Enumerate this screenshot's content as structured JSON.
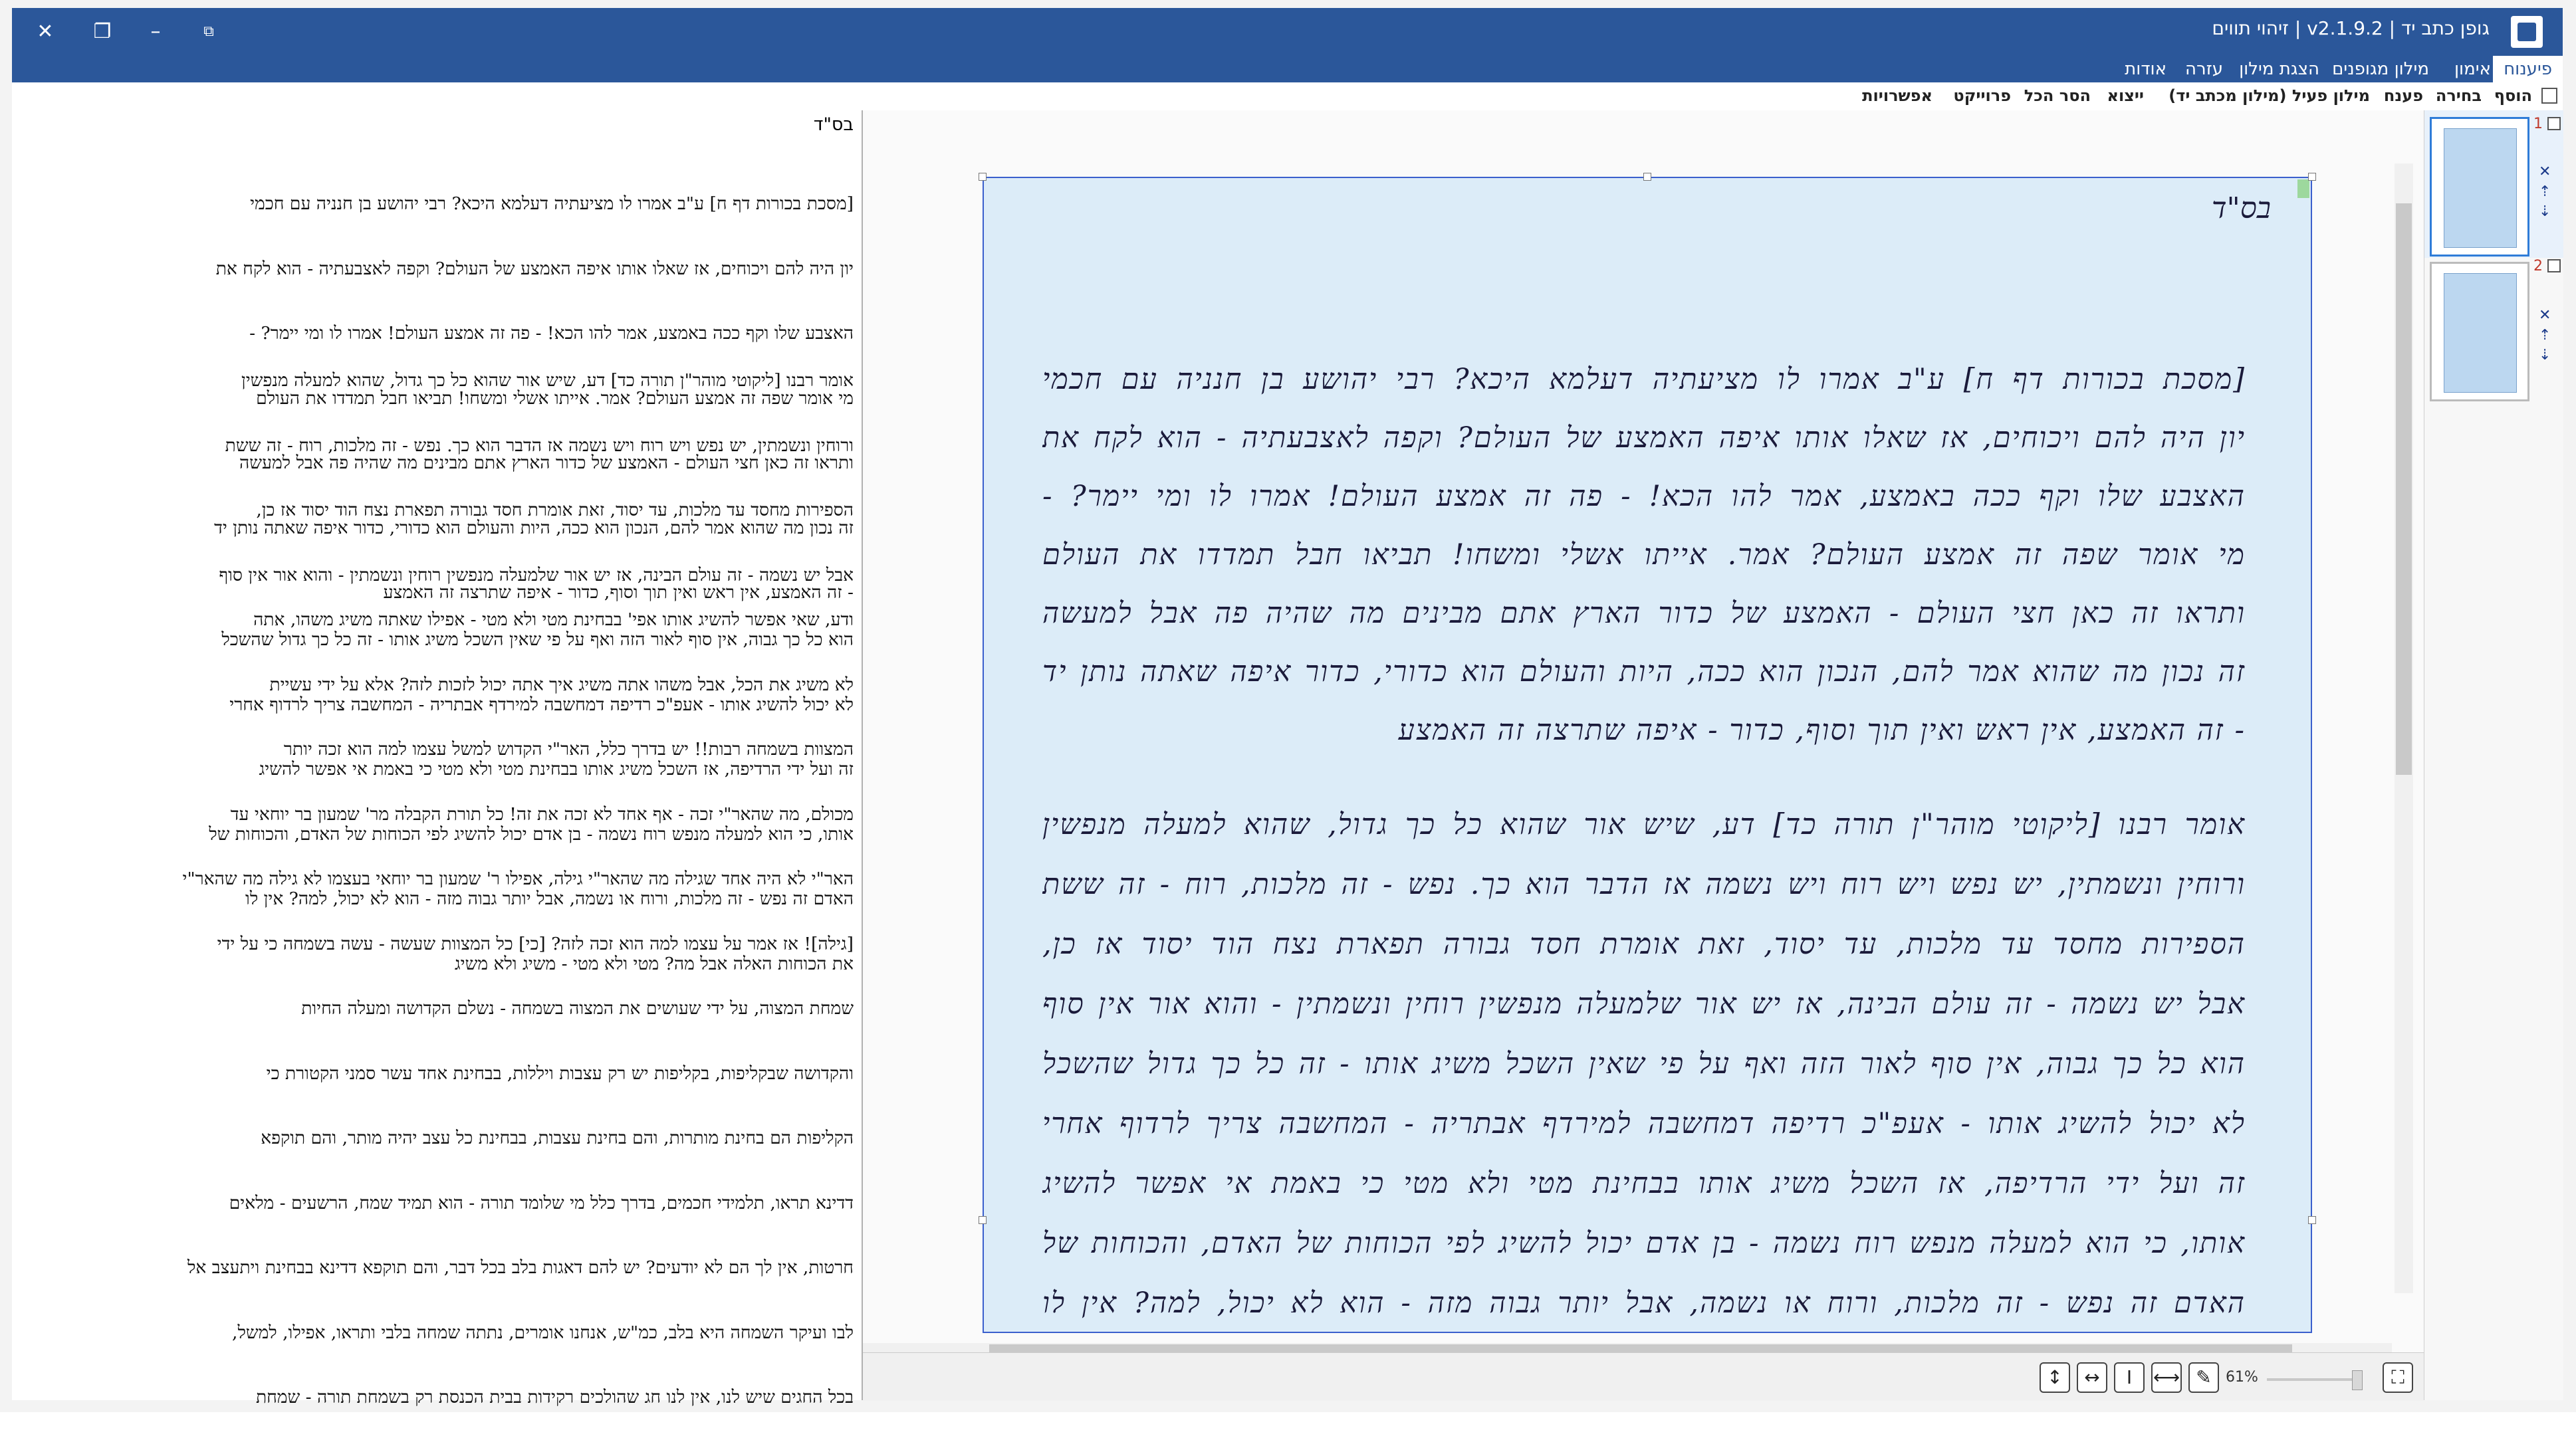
{
  "window": {
    "title": "גופן כתב יד | v2.1.9.2 | זיהוי תווים"
  },
  "ribbon": {
    "tabs": [
      "פיענוח",
      "אימון",
      "מילון מגופנים",
      "הצגת מילון",
      "עזרה",
      "אודות"
    ]
  },
  "toolbar": {
    "items": [
      "הוסף",
      "בחירה",
      "פענח",
      "מילון פעיל (מילון מכתב יד)",
      "ייצוא",
      "הסר הכל",
      "פרוייקט",
      "אפשרויות"
    ]
  },
  "left_text": {
    "header": "בס\"ד",
    "paragraph1": [
      "[מסכת בכורות דף ח] ע\"ב אמרו לו מציעתיה דעלמא היכא? רבי יהושע בן חנניה עם חכמי",
      "יון היה להם ויכוחים, אז שאלו אותו איפה האמצע של העולם? וקפה לאצבעתיה - הוא לקח את",
      "האצבע שלו וקף ככה באמצע, אמר להו הכא! - פה זה אמצע העולם! אמרו לו ומי יימר? -",
      "מי אומר שפה זה אמצע העולם? אמר. אייתו אשלי ומשחו! תביאו חבל תמדדו את העולם",
      "ותראו זה כאן חצי העולם - האמצע של כדור הארץ אתם מבינים מה שהיה פה אבל למעשה",
      "זה נכון מה שהוא אמר להם, הנכון הוא ככה, היות והעולם הוא כדורי, כדור איפה שאתה נותן יד",
      "- זה האמצע, אין ראש ואין תוך וסוף, כדור - איפה שתרצה זה האמצע"
    ],
    "paragraph2": [
      "אומר רבנו [ליקוטי מוהר\"ן תורה כד] דע, שיש אור שהוא כל כך גדול, שהוא למעלה מנפשין",
      "ורוחין ונשמתין, יש נפש ויש רוח ויש נשמה אז הדבר הוא כך. נפש - זה מלכות, רוח - זה ששת",
      "הספירות מחסד עד מלכות, עד יסוד, זאת אומרת חסד גבורה תפארת נצח הוד יסוד אז כן,",
      "אבל יש נשמה - זה עולם הבינה, אז יש אור שלמעלה מנפשין רוחין ונשמתין - והוא אור אין סוף",
      "הוא כל כך גבוה, אין סוף לאור הזה ואף על פי שאין השכל משיג אותו - זה כל כך גדול שהשכל",
      "לא יכול להשיג אותו - אעפ\"כ רדיפה דמחשבה למירדף אבתריה - המחשבה צריך לרדוף אחרי",
      "זה ועל ידי הרדיפה, אז השכל משיג אותו בבחינת מטי ולא מטי כי באמת אי אפשר להשיג",
      "אותו, כי הוא למעלה מנפש רוח נשמה - בן אדם יכול להשיג לפי הכוחות של האדם, והכוחות של",
      "האדם זה נפש - זה מלכות, ורוח או נשמה, אבל יותר גבוה מזה - הוא לא יכול, למה? אין לו",
      "את הכוחות האלה אבל מה? מטי ולא מטי - משיג ולא משיג"
    ],
    "paragraph3": [
      "ודע, שאי אפשר להשיג אותו אפי' בבחינת מטי ולא מטי - אפילו שאתה משיג משהו, אתה",
      "לא משיג את הכל, אבל משהו אתה משיג איך אתה יכול לזכות לזה? אלא על ידי עשיית",
      "המצוות בשמחה רבות!! יש בדרך כלל, האר\"י הקדוש למשל עצמו למה הוא זכה יותר",
      "מכולם, מה שהאר\"י זכה - אף אחד לא זכה את זה! כל תורת הקבלה מר' שמעון בר יוחאי עד",
      "האר\"י לא היה אחד שגילה מה שהאר\"י גילה, אפילו ר' שמעון בר יוחאי בעצמו לא גילה מה שהאר\"י",
      "[גילה]! אז אמר על עצמו למה הוא זכה לזה? [כי] כל המצוות שעשה - עשה בשמחה כי על ידי",
      "שמחת המצוה, על ידי שעושים את המצוה בשמחה - נשלם הקדושה ומעלה החיות",
      "והקדושה שבקליפות, בקליפות יש רק עצבות ויללות, בבחינת אחד עשר סמני הקטורת כי",
      "הקליפות הם בחינת מותרות, והם בחינת עצבות, בבחינת כל עצב יהיה מותר, והם תוקפא",
      "דדינא תראו, תלמידי חכמים, בדרך כלל מי שלומד תורה - הוא תמיד שמח, הרשעים - מלאים",
      "חרטות, אין לך הם לא יודעים? יש להם דאגות בלב בכל דבר, והם תוקפא דדינא בבחינת ויתעצב אל",
      "לבו ועיקר השמחה היא בלב, כמ\"ש, אנחנו אומרים, נתתה שמחה בלבי ותראו, אפילו, למשל,",
      "בכל החגים שיש לנו, אין לנו חג שהולכים רקידות בבית הכנסת רק בשמחת תורה - שמחת"
    ]
  },
  "handwriting": {
    "header": "בס\"ד",
    "lines": [
      "[מסכת בכורות דף ח] ע\"ב אמרו לו מציעתיה דעלמא היכא? רבי יהושע בן חנניה עם חכמי",
      "יון היה להם ויכוחים, אז שאלו אותו איפה האמצע של העולם? וקפה לאצבעתיה - הוא לקח את",
      "האצבע שלו וקף ככה באמצע, אמר להו הכא! - פה זה אמצע העולם! אמרו לו ומי יימר? -",
      "מי אומר שפה זה אמצע העולם? אמר. אייתו אשלי ומשחו! תביאו חבל תמדדו את העולם",
      "ותראו זה כאן חצי העולם - האמצע של כדור הארץ אתם מבינים מה שהיה פה אבל למעשה",
      "זה נכון מה שהוא אמר להם, הנכון הוא ככה, היות והעולם הוא כדורי, כדור איפה שאתה נותן יד",
      "- זה האמצע, אין ראש ואין תוך וסוף, כדור - איפה שתרצה זה האמצע",
      "אומר רבנו [ליקוטי מוהר\"ן תורה כד] דע, שיש אור שהוא כל כך גדול, שהוא למעלה מנפשין",
      "ורוחין ונשמתין, יש נפש ויש רוח ויש נשמה אז הדבר הוא כך. נפש - זה מלכות, רוח - זה ששת",
      "הספירות מחסד עד מלכות, עד יסוד, זאת אומרת חסד גבורה תפארת נצח הוד יסוד אז כן,",
      "אבל יש נשמה - זה עולם הבינה, אז יש אור שלמעלה מנפשין רוחין ונשמתין - והוא אור אין סוף",
      "הוא כל כך גבוה, אין סוף לאור הזה ואף על פי שאין השכל משיג אותו - זה כל כך גדול שהשכל",
      "לא יכול להשיג אותו - אעפ\"כ רדיפה דמחשבה למירדף אבתריה - המחשבה צריך לרדוף אחרי",
      "זה ועל ידי הרדיפה, אז השכל משיג אותו בבחינת מטי ולא מטי כי באמת אי אפשר להשיג",
      "אותו, כי הוא למעלה מנפש רוח נשמה - בן אדם יכול להשיג לפי הכוחות של האדם, והכוחות של",
      "האדם זה נפש - זה מלכות, ורוח או נשמה, אבל יותר גבוה מזה - הוא לא יכול, למה? אין לו"
    ]
  },
  "viewbar": {
    "zoom": "61%"
  },
  "thumbnails": {
    "pages": [
      "1",
      "2"
    ]
  }
}
